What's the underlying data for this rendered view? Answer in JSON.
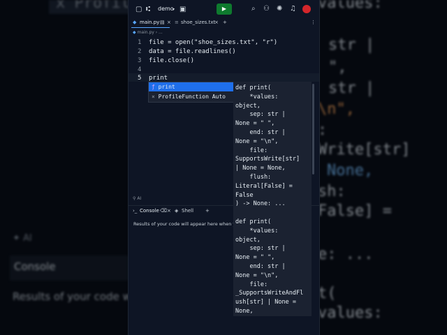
{
  "topbar": {
    "project_name": "demo",
    "run_icon": "play-icon"
  },
  "tabs": [
    {
      "label": "main.py"
    },
    {
      "label": "shoe_sizes.txt"
    }
  ],
  "breadcrumb": {
    "file": "main.py",
    "more": "..."
  },
  "editor": {
    "lines": [
      {
        "num": "1",
        "code": "file = open(\"shoe_sizes.txt\", \"r\")"
      },
      {
        "num": "2",
        "code": "data = file.readlines()"
      },
      {
        "num": "3",
        "code": "file.close()"
      },
      {
        "num": "4",
        "code": ""
      },
      {
        "num": "5",
        "code": "print"
      }
    ]
  },
  "autocomplete": {
    "items": [
      {
        "label": "print"
      },
      {
        "label": "ProfileFunction Auto"
      }
    ]
  },
  "signature": {
    "text": "def print(\n    *values:\nobject,\n    sep: str |\nNone = \" \",\n    end: str |\nNone = \"\\n\",\n    file:\nSupportsWrite[str]\n| None = None,\n    flush:\nLiteral[False] =\nFalse\n) -> None: ...\n\ndef print(\n    *values:\nobject,\n    sep: str |\nNone = \" \",\n    end: str |\nNone = \"\\n\",\n    file:\n_SupportsWriteAndFl\nush[str] | None =\nNone,"
  },
  "ai_label": "AI",
  "bottom_pane": {
    "console_label": "Console",
    "shell_label": "Shell",
    "results_text": "Results of your code will appear here when you"
  },
  "background": {
    "top_text": "x Profile",
    "code_lines": [
      "values:",
      "str |",
      "\",",
      "str |",
      "\\n\",",
      ":",
      "Write[str]",
      "None,",
      "sh:",
      "False] =",
      "e: ...",
      "t(",
      "values:"
    ],
    "ai_label": "AI",
    "console_label": "Console",
    "results_text": "Results of your code will"
  }
}
